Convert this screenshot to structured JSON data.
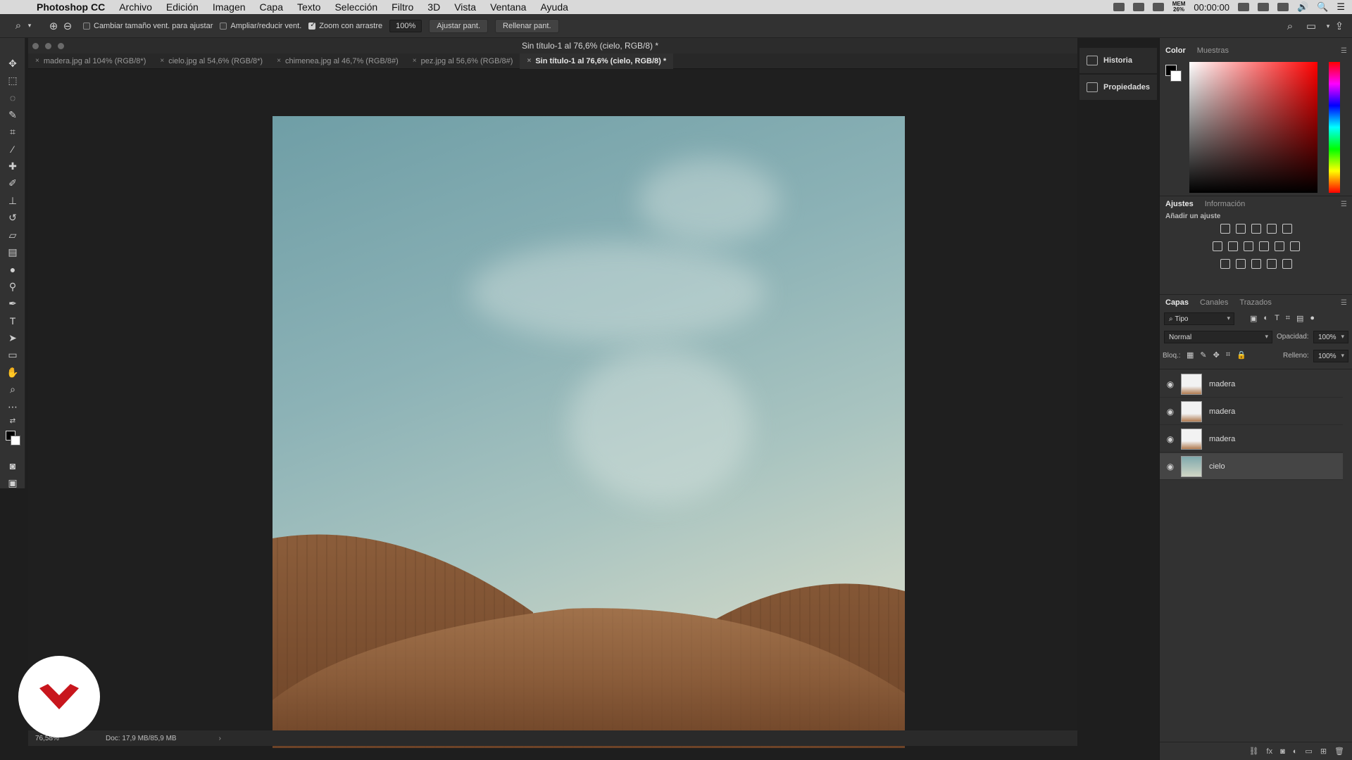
{
  "menubar": {
    "app_name": "Photoshop CC",
    "items": [
      "Archivo",
      "Edición",
      "Imagen",
      "Capa",
      "Texto",
      "Selección",
      "Filtro",
      "3D",
      "Vista",
      "Ventana",
      "Ayuda"
    ],
    "mem_label": "MEM",
    "mem_value": "26%",
    "clock": "00:00:00"
  },
  "options": {
    "resize_windows": "Cambiar tamaño vent. para ajustar",
    "zoom_all_windows": "Ampliar/reducir vent.",
    "scrubby_zoom": "Zoom con arrastre",
    "zoom_value": "100%",
    "fit_screen": "Ajustar pant.",
    "fill_screen": "Rellenar pant."
  },
  "document": {
    "title": "Sin título-1 al 76,6% (cielo, RGB/8) *",
    "tabs": [
      {
        "label": "madera.jpg al 104% (RGB/8*)",
        "active": false
      },
      {
        "label": "cielo.jpg al 54,6% (RGB/8*)",
        "active": false
      },
      {
        "label": "chimenea.jpg al 46,7% (RGB/8#)",
        "active": false
      },
      {
        "label": "pez.jpg al 56,6% (RGB/8#)",
        "active": false
      },
      {
        "label": "Sin título-1 al 76,6% (cielo, RGB/8) *",
        "active": true
      }
    ],
    "status_zoom": "76,58%",
    "status_doc": "Doc: 17,9 MB/85,9 MB"
  },
  "collapsed_panels": {
    "history": "Historia",
    "properties": "Propiedades"
  },
  "color_panel": {
    "tabs": [
      "Color",
      "Muestras"
    ]
  },
  "adjustments_panel": {
    "tabs": [
      "Ajustes",
      "Información"
    ],
    "add_label": "Añadir un ajuste"
  },
  "layers_panel": {
    "tabs": [
      "Capas",
      "Canales",
      "Trazados"
    ],
    "filter": "Tipo",
    "blend_mode": "Normal",
    "opacity_label": "Opacidad:",
    "opacity_value": "100%",
    "lock_label": "Bloq.:",
    "fill_label": "Relleno:",
    "fill_value": "100%",
    "layers": [
      {
        "name": "madera",
        "selected": false
      },
      {
        "name": "madera",
        "selected": false
      },
      {
        "name": "madera",
        "selected": false
      },
      {
        "name": "cielo",
        "selected": true
      }
    ]
  },
  "colors": {
    "panel_bg": "#323232",
    "accent_logo": "#c8161d"
  }
}
